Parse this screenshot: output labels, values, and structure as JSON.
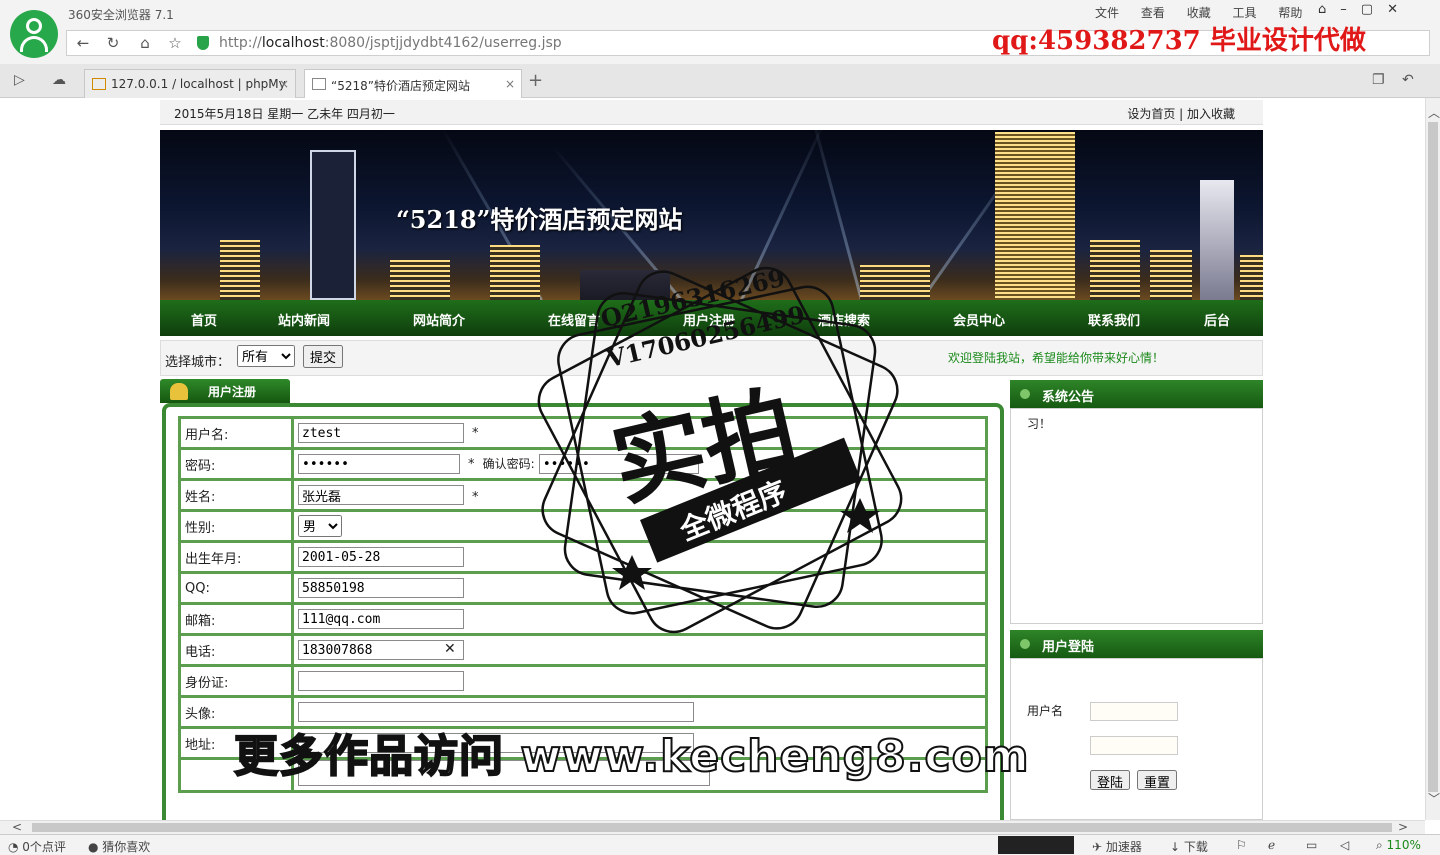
{
  "browser": {
    "title": "360安全浏览器 7.1",
    "menu": [
      "文件",
      "查看",
      "收藏",
      "工具",
      "帮助"
    ],
    "url_prefix": "http://",
    "url_host": "localhost",
    "url_rest": ":8080/jsptjjdydbt4162/userreg.jsp",
    "tabs": [
      {
        "label": "127.0.0.1 / localhost | phpMy"
      },
      {
        "label": "“5218”特价酒店预定网站"
      }
    ]
  },
  "watermarks": {
    "qq_ad": "qq:459382737 毕业设计代做",
    "stamp_line1": "Q2196316269",
    "stamp_line2": "V17060256499",
    "stamp_big": "实拍",
    "stamp_ribbon": "全微程序",
    "bottom_ad": "更多作品访问 www.kecheng8.com"
  },
  "site": {
    "date": "2015年5月18日  星期一  乙未年  四月初一",
    "top_links": "设为首页  |  加入收藏",
    "banner_title": "“5218”特价酒店预定网站",
    "nav": [
      "首页",
      "站内新闻",
      "网站简介",
      "在线留言",
      "用户注册",
      "酒店搜索",
      "会员中心",
      "联系我们",
      "后台"
    ],
    "city_label": "选择城市：",
    "city_selected": "所有",
    "city_submit": "提交",
    "welcome": "欢迎登陆我站，希望能给你带来好心情！"
  },
  "register": {
    "header": "用户注册",
    "labels": {
      "username": "用户名:",
      "password": "密码:",
      "confirm": "确认密码:",
      "name": "姓名:",
      "gender": "性别:",
      "birth": "出生年月:",
      "qq": "QQ:",
      "email": "邮箱:",
      "phone": "电话:",
      "idcard": "身份证:",
      "avatar": "头像:",
      "address": "地址:"
    },
    "values": {
      "username": "ztest",
      "password": "••••••",
      "confirm": "••••••",
      "name": "张光磊",
      "gender": "男",
      "birth": "2001-05-28",
      "qq": "58850198",
      "email": "111@qq.com",
      "phone": "183007868",
      "idcard": "",
      "address": ""
    },
    "required_mark": "*"
  },
  "sidebar": {
    "notice_title": "系统公告",
    "notice_text": "习！",
    "login_title": "用户登陆",
    "login_user_label": "用户名",
    "login_button": "登陆",
    "reset_button": "重置"
  },
  "status": {
    "comments": "0个点评",
    "guess": "猜你喜欢",
    "accelerator": "加速器",
    "download": "下载",
    "zoom": "110%"
  },
  "colors": {
    "nav_green": "#1f6e1a",
    "table_border": "#5b9e4e",
    "welcome_text": "#1b8a1b",
    "ad_red": "#e01818"
  }
}
